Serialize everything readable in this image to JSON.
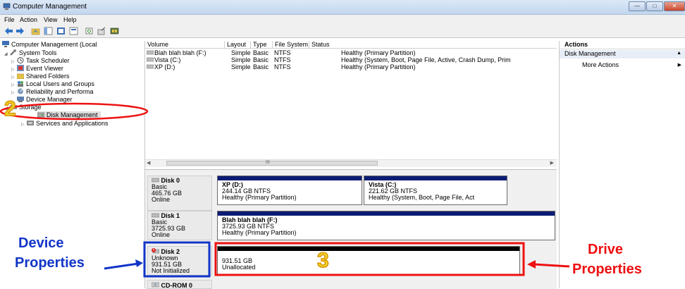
{
  "window": {
    "title": "Computer Management"
  },
  "menu": [
    "File",
    "Action",
    "View",
    "Help"
  ],
  "tree": {
    "root": "Computer Management (Local",
    "system_tools": "System Tools",
    "items": [
      "Task Scheduler",
      "Event Viewer",
      "Shared Folders",
      "Local Users and Groups",
      "Reliability and Performa",
      "Device Manager"
    ],
    "storage": "Storage",
    "disk_management": "Disk Management",
    "services": "Services and Applications"
  },
  "volumes": {
    "columns": [
      "Volume",
      "Layout",
      "Type",
      "File System",
      "Status"
    ],
    "rows": [
      {
        "volume": "Blah blah blah (F:)",
        "layout": "Simple",
        "type": "Basic",
        "fs": "NTFS",
        "status": "Healthy (Primary Partition)"
      },
      {
        "volume": "Vista (C:)",
        "layout": "Simple",
        "type": "Basic",
        "fs": "NTFS",
        "status": "Healthy (System, Boot, Page File, Active, Crash Dump, Prim"
      },
      {
        "volume": "XP (D:)",
        "layout": "Simple",
        "type": "Basic",
        "fs": "NTFS",
        "status": "Healthy (Primary Partition)"
      }
    ],
    "scroll_marker": "III"
  },
  "disks": [
    {
      "name": "Disk 0",
      "kind": "Basic",
      "size": "465.76 GB",
      "state": "Online",
      "partitions": [
        {
          "name": "XP  (D:)",
          "size": "244.14 GB NTFS",
          "status": "Healthy (Primary Partition)"
        },
        {
          "name": "Vista  (C:)",
          "size": "221.62 GB NTFS",
          "status": "Healthy (System, Boot, Page File, Act"
        }
      ]
    },
    {
      "name": "Disk 1",
      "kind": "Basic",
      "size": "3725.93 GB",
      "state": "Online",
      "partitions": [
        {
          "name": "Blah blah blah  (F:)",
          "size": "3725.93 GB NTFS",
          "status": "Healthy (Primary Partition)"
        }
      ]
    },
    {
      "name": "Disk 2",
      "kind": "Unknown",
      "size": "931.51 GB",
      "state": "Not Initialized",
      "partitions": [
        {
          "name": "",
          "size": "931.51 GB",
          "status": "Unallocated"
        }
      ]
    },
    {
      "name": "CD-ROM 0"
    }
  ],
  "actions": {
    "header": "Actions",
    "section": "Disk Management",
    "more": "More Actions"
  },
  "annotations": {
    "num2": "2",
    "num3": "3",
    "device_1": "Device",
    "device_2": "Properties",
    "drive_1": "Drive",
    "drive_2": "Properties"
  },
  "colors": {
    "annotation_blue": "#1235c8",
    "annotation_red": "#e11111",
    "partition_bar": "#0b1c74"
  }
}
